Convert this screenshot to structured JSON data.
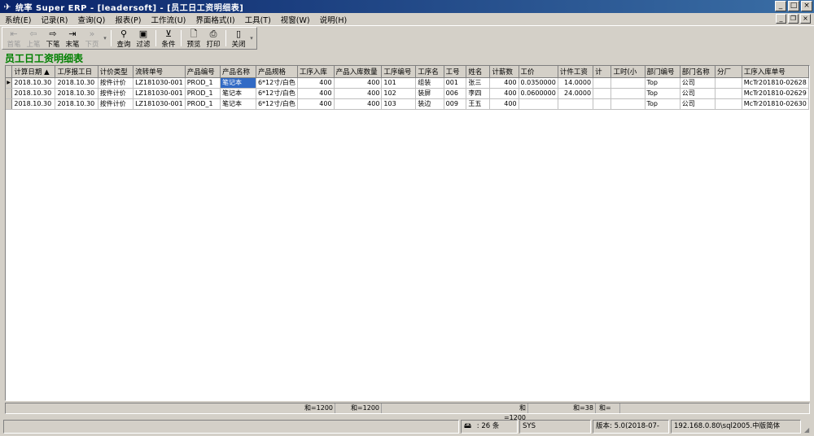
{
  "window": {
    "title": "统率 Super ERP - [leadersoft] - [员工日工资明细表]"
  },
  "menu": [
    "系统(E)",
    "记录(R)",
    "查询(Q)",
    "报表(P)",
    "工作流(U)",
    "界面格式(I)",
    "工具(T)",
    "视窗(W)",
    "说明(H)"
  ],
  "toolbar": {
    "first": "首笔",
    "prev": "上笔",
    "next": "下笔",
    "last": "末笔",
    "pagedown": "下页",
    "query": "查询",
    "filter": "过滤",
    "condition": "条件",
    "preview": "预览",
    "print": "打印",
    "close": "关闭"
  },
  "page_title": "员工日工资明细表",
  "grid": {
    "columns": [
      "计算日期 ▲",
      "工序报工日",
      "计价类型",
      "流转单号",
      "产品编号",
      "产品名称",
      "产品规格",
      "工序入库",
      "产品入库数量",
      "工序编号",
      "工序名",
      "工号",
      "姓名",
      "计薪数",
      "工价",
      "计件工资",
      "计",
      "工时(小",
      "部门编号",
      "部门名称",
      "分厂",
      "工序入库单号"
    ],
    "rows": [
      [
        "2018.10.30",
        "2018.10.30",
        "按件计价",
        "LZ181030-001",
        "PROD_1",
        "笔记本",
        "6*12寸/白色",
        "400",
        "400",
        "101",
        "组装",
        "001",
        "张三",
        "400",
        "0.0350000",
        "14.0000",
        "",
        "",
        "Top",
        "公司",
        "",
        "McTr201810-02628"
      ],
      [
        "2018.10.30",
        "2018.10.30",
        "按件计价",
        "LZ181030-001",
        "PROD_1",
        "笔记本",
        "6*12寸/白色",
        "400",
        "400",
        "102",
        "装屏",
        "006",
        "李四",
        "400",
        "0.0600000",
        "24.0000",
        "",
        "",
        "Top",
        "公司",
        "",
        "McTr201810-02629"
      ],
      [
        "2018.10.30",
        "2018.10.30",
        "按件计价",
        "LZ181030-001",
        "PROD_1",
        "笔记本",
        "6*12寸/白色",
        "400",
        "400",
        "103",
        "装边",
        "009",
        "王五",
        "400",
        "",
        "",
        "",
        "",
        "Top",
        "公司",
        "",
        "McTr201810-02630"
      ]
    ]
  },
  "summary": {
    "s1": "和=1200",
    "s2": "和=1200",
    "s3": "和=1200",
    "s4": "和=38",
    "s5": "和="
  },
  "status": {
    "count": ": 26 条",
    "user": "SYS",
    "version": "版本: 5.0(2018-07-",
    "server": "192.168.0.80\\sql2005.中版简体"
  }
}
